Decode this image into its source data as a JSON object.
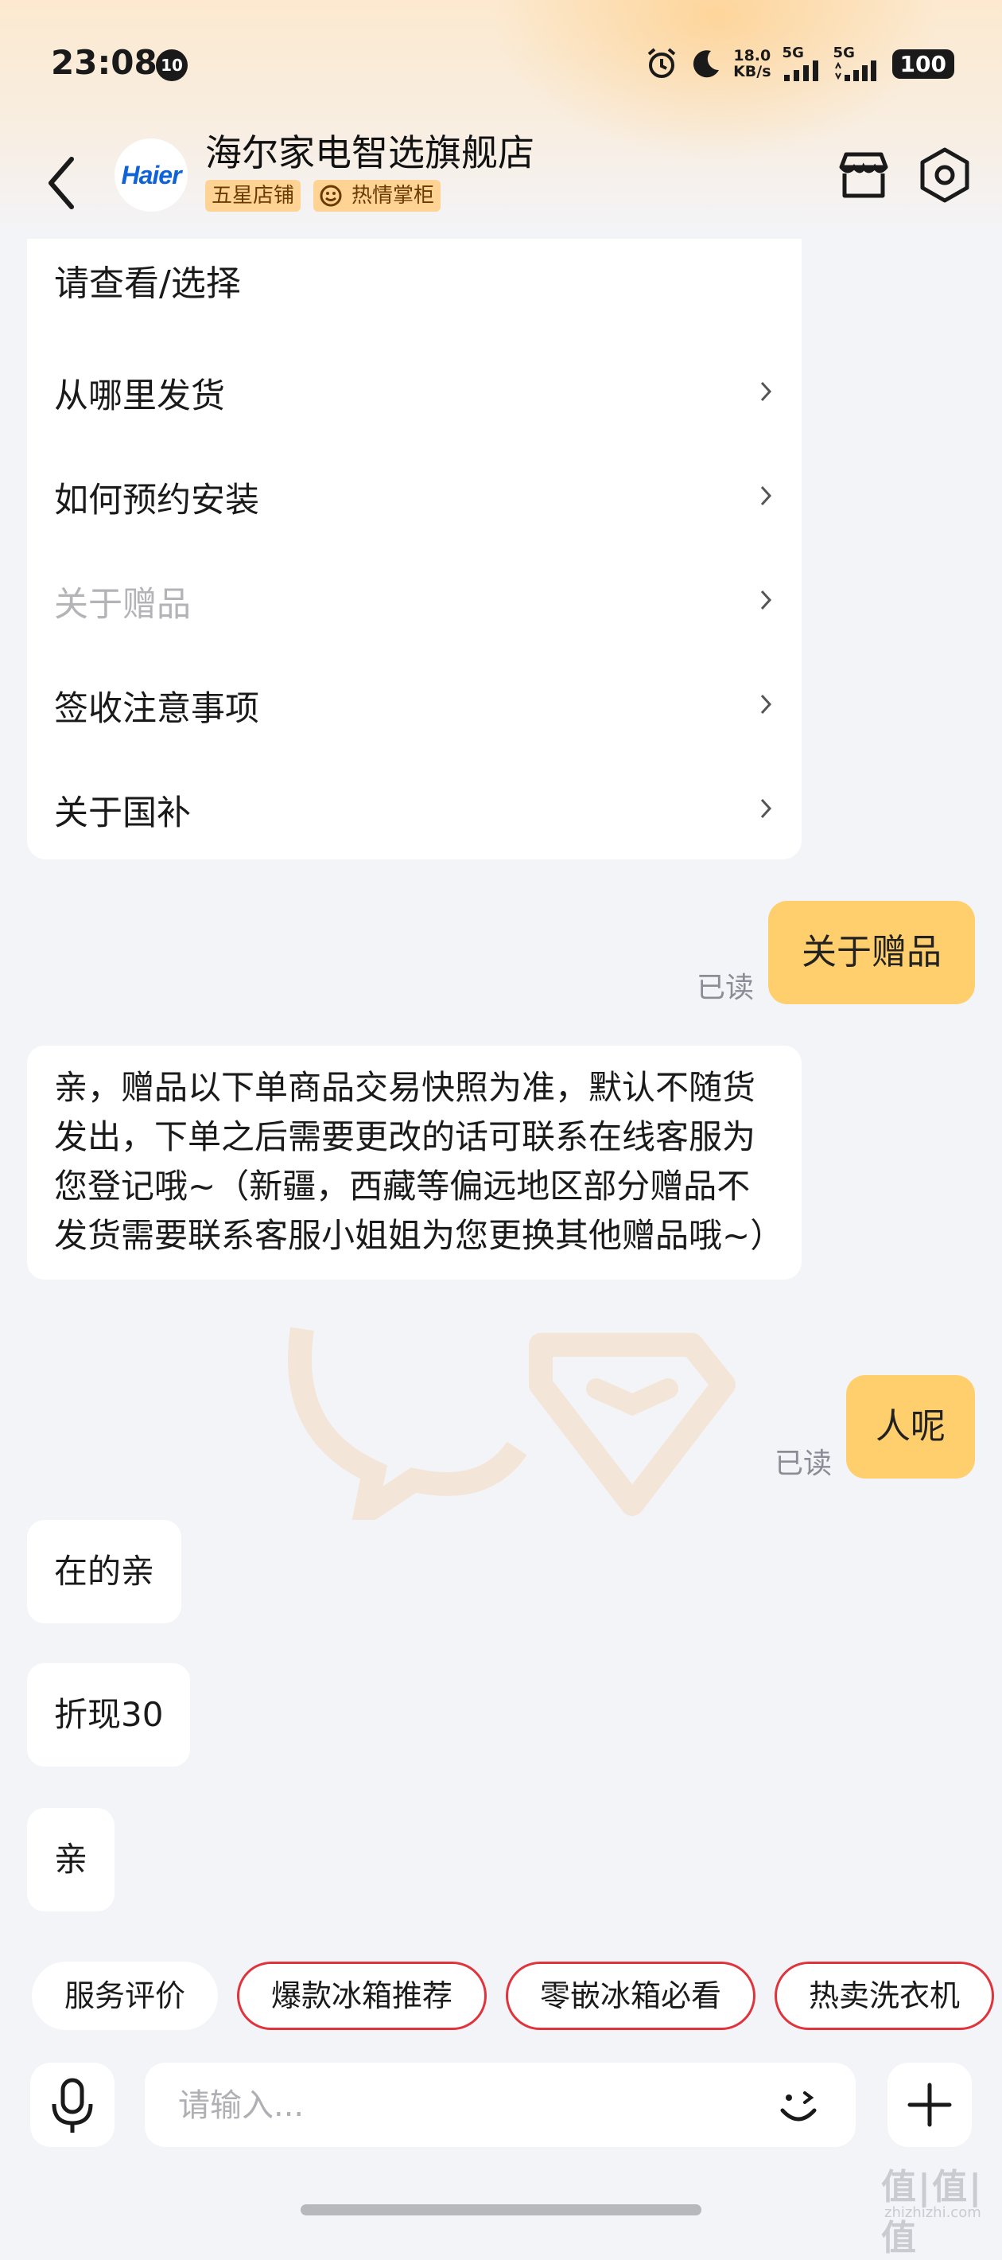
{
  "status_bar": {
    "time": "23:08",
    "notification_count": "10",
    "network_speed_value": "18.0",
    "network_speed_unit": "KB/s",
    "signal1_label": "5G",
    "signal2_label": "5G",
    "battery": "100"
  },
  "header": {
    "avatar_text": "Haier",
    "shop_name": "海尔家电智选旗舰店",
    "tag_rating": "五星店铺",
    "tag_host": "热情掌柜"
  },
  "menu": {
    "title": "请查看/选择",
    "items": [
      {
        "label": "从哪里发货"
      },
      {
        "label": "如何预约安装"
      },
      {
        "label": "关于赠品"
      },
      {
        "label": "签收注意事项"
      },
      {
        "label": "关于国补"
      }
    ]
  },
  "messages": {
    "user1": "关于赠品",
    "read1": "已读",
    "reply_gift": "亲，赠品以下单商品交易快照为准，默认不随货发出，下单之后需要更改的话可联系在线客服为您登记哦~（新疆，西藏等偏远地区部分赠品不发货需要联系客服小姐姐为您更换其他赠品哦~）",
    "user2": "人呢",
    "read2": "已读",
    "reply1": "在的亲",
    "reply2": "折现30",
    "reply3": "亲"
  },
  "quick_replies": [
    "服务评价",
    "爆款冰箱推荐",
    "零嵌冰箱必看",
    "热卖洗衣机"
  ],
  "input": {
    "placeholder": "请输入..."
  },
  "watermark": {
    "text": "值|值|值",
    "sub": "zhizhizhi.com"
  },
  "colors": {
    "user_bubble": "#ffcf6e",
    "chip_border": "#e0343c",
    "tag_bg": "#ffd394"
  }
}
